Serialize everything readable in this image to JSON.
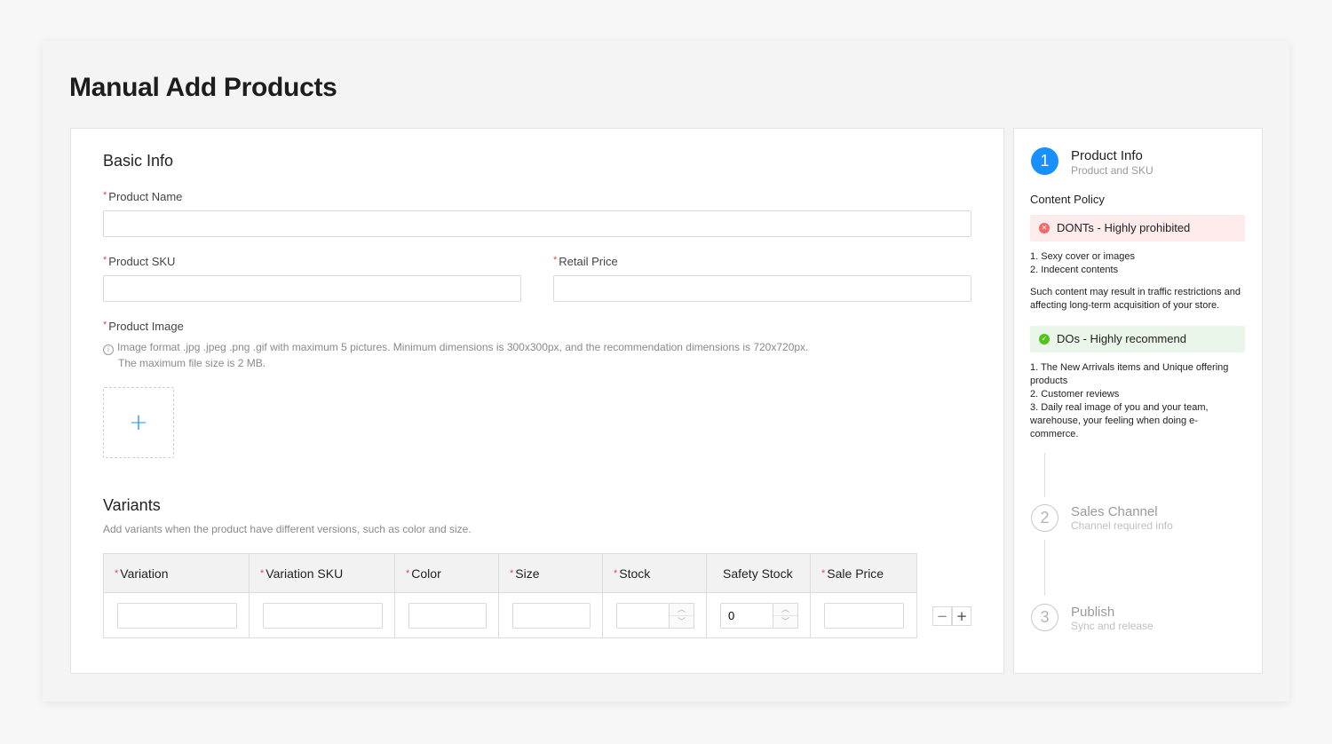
{
  "page": {
    "title": "Manual Add Products"
  },
  "basic_info": {
    "title": "Basic Info",
    "product_name_label": "Product Name",
    "product_sku_label": "Product SKU",
    "retail_price_label": "Retail Price",
    "product_image_label": "Product Image",
    "image_hint_line1": "Image format .jpg .jpeg .png .gif with maximum 5 pictures. Minimum dimensions is 300x300px, and the recommendation dimensions is 720x720px.",
    "image_hint_line2": "The maximum file size is 2 MB.",
    "upload_plus": "+"
  },
  "variants": {
    "title": "Variants",
    "description": "Add variants when the product have different versions, such as color and size.",
    "columns": [
      "Variation",
      "Variation SKU",
      "Color",
      "Size",
      "Stock",
      "Safety Stock",
      "Sale Price"
    ],
    "safety_stock_value": "0",
    "remove_row": "−",
    "add_row": "+"
  },
  "steps": [
    {
      "number": "1",
      "title": "Product Info",
      "subtitle": "Product and SKU",
      "active": true
    },
    {
      "number": "2",
      "title": "Sales Channel",
      "subtitle": "Channel required info",
      "active": false
    },
    {
      "number": "3",
      "title": "Publish",
      "subtitle": "Sync and release",
      "active": false
    }
  ],
  "content_policy": {
    "heading": "Content Policy",
    "donts_title": "DONTs - Highly prohibited",
    "donts_items": [
      "1. Sexy cover or images",
      "2. Indecent contents"
    ],
    "donts_note_line1": "Such content may result in traffic restrictions and",
    "donts_note_line2": "affecting long-term acquisition of your store.",
    "dos_title": "DOs - Highly recommend",
    "dos_lines": [
      "1. The New Arrivals items and Unique offering",
      "products",
      "2. Customer reviews",
      "3. Daily real image of you and your team,",
      "warehouse, your feeling when doing e-",
      "commerce."
    ]
  },
  "colors": {
    "accent": "#1890ff",
    "required": "#e5484d",
    "error_bg": "#fdeceb",
    "success_bg": "#eaf6e9"
  }
}
